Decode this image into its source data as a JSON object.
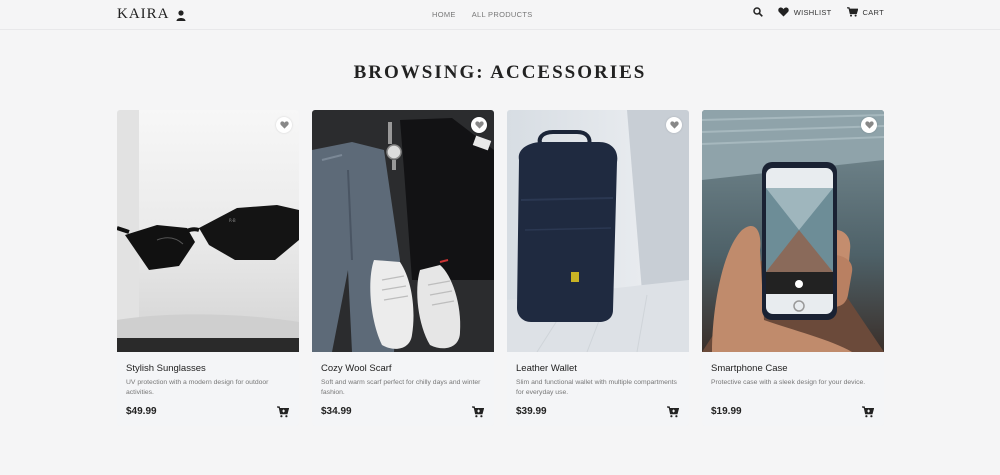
{
  "header": {
    "brand": "KAIRA",
    "nav": [
      {
        "label": "HOME"
      },
      {
        "label": "ALL PRODUCTS"
      }
    ],
    "wishlist_label": "WISHLIST",
    "cart_label": "CART",
    "icons": [
      "user-icon",
      "search-icon",
      "heart-icon",
      "cart-icon"
    ]
  },
  "page": {
    "title": "BROWSING: ACCESSORIES"
  },
  "products": [
    {
      "name": "Stylish Sunglasses",
      "description": "UV protection with a modern design for outdoor activities.",
      "price": "$49.99",
      "image": "sunglasses-photo"
    },
    {
      "name": "Cozy Wool Scarf",
      "description": "Soft and warm scarf perfect for chilly days and winter fashion.",
      "price": "$34.99",
      "image": "flatlay-outfit-photo"
    },
    {
      "name": "Leather Wallet",
      "description": "Slim and functional wallet with multiple compartments for everyday use.",
      "price": "$39.99",
      "image": "backpack-photo"
    },
    {
      "name": "Smartphone Case",
      "description": "Protective case with a sleek design for your device.",
      "price": "$19.99",
      "image": "phone-in-hand-photo"
    }
  ],
  "colors": {
    "background": "#f5f5f6",
    "card": "#f0f1f3",
    "text": "#222222",
    "muted": "#777777"
  }
}
